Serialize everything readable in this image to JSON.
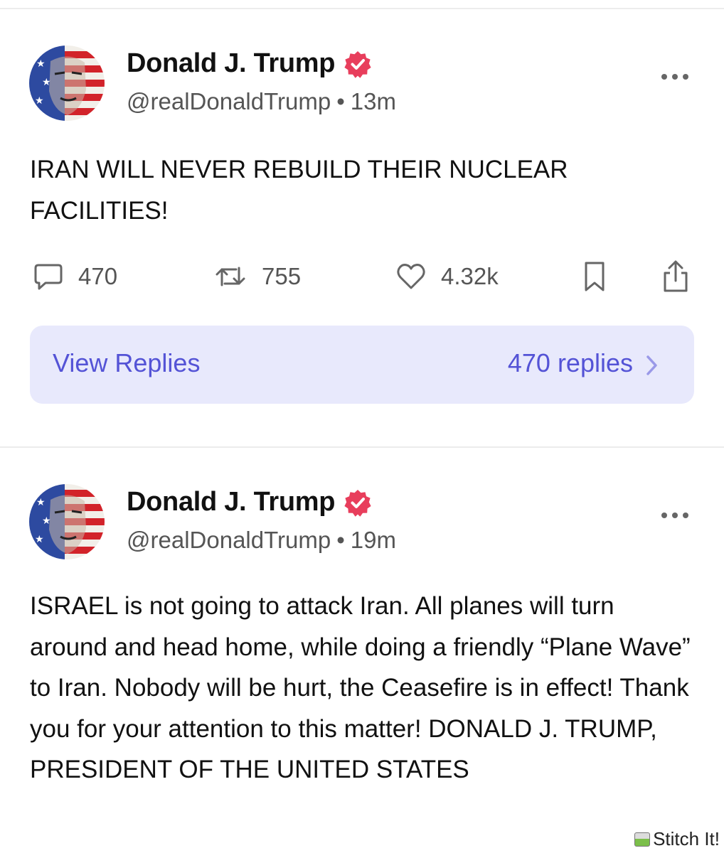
{
  "colors": {
    "accent": "#5453d6",
    "verified_badge": "#e83e5c",
    "replies_bg": "#e8e9fc",
    "muted_text": "#555555"
  },
  "posts": [
    {
      "author_name": "Donald J. Trump",
      "verified_icon": "verified-badge-icon",
      "handle": "@realDonaldTrump",
      "separator": "•",
      "time": "13m",
      "text": "IRAN WILL NEVER REBUILD THEIR NUCLEAR FACILITIES!",
      "reply_count": "470",
      "retruth_count": "755",
      "like_count": "4.32k",
      "view_replies_label": "View Replies",
      "replies_summary": "470 replies"
    },
    {
      "author_name": "Donald J. Trump",
      "verified_icon": "verified-badge-icon",
      "handle": "@realDonaldTrump",
      "separator": "•",
      "time": "19m",
      "text": "ISRAEL is not going to attack Iran. All planes will turn around and head home, while doing a friendly “Plane Wave” to Iran. Nobody will be hurt, the Ceasefire is in effect! Thank you for your attention to this matter! DONALD J. TRUMP, PRESIDENT OF THE UNITED STATES"
    }
  ],
  "watermark": "Stitch It!"
}
